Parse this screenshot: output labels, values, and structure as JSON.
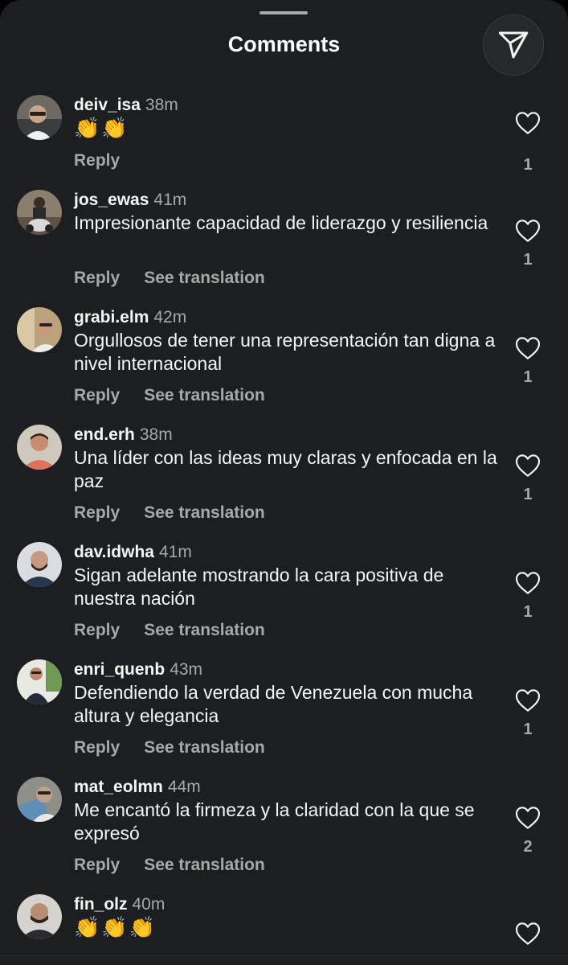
{
  "header": {
    "title": "Comments",
    "share_icon": "send-paper-plane-icon"
  },
  "colors": {
    "background": "#1c1e21",
    "text_primary": "#f5f5f5",
    "text_secondary": "#a8a8a8"
  },
  "comments": [
    {
      "username": "deiv_isa",
      "time": "38m",
      "text": "👏👏",
      "reply": "Reply",
      "translate": "",
      "likes": "1"
    },
    {
      "username": "jos_ewas",
      "time": "41m",
      "text": "Impresionante capacidad de liderazgo y resiliencia",
      "reply": "Reply",
      "translate": "See translation",
      "likes": "1"
    },
    {
      "username": "grabi.elm",
      "time": "42m",
      "text": "Orgullosos de tener una representación tan digna a nivel internacional",
      "reply": "Reply",
      "translate": "See translation",
      "likes": "1"
    },
    {
      "username": "end.erh",
      "time": "38m",
      "text": "Una líder con las ideas muy claras y enfocada en la paz",
      "reply": "Reply",
      "translate": "See translation",
      "likes": "1"
    },
    {
      "username": "dav.idwha",
      "time": "41m",
      "text": "Sigan adelante mostrando la cara positiva de nuestra nación",
      "reply": "Reply",
      "translate": "See translation",
      "likes": "1"
    },
    {
      "username": "enri_quenb",
      "time": "43m",
      "text": "Defendiendo la verdad de Venezuela con mucha altura y elegancia",
      "reply": "Reply",
      "translate": "See translation",
      "likes": "1"
    },
    {
      "username": "mat_eolmn",
      "time": "44m",
      "text": "Me encantó la firmeza y la claridad con la que se expresó",
      "reply": "Reply",
      "translate": "See translation",
      "likes": "2"
    },
    {
      "username": "fin_olz",
      "time": "40m",
      "text": "👏👏👏",
      "reply": "",
      "translate": "",
      "likes": ""
    }
  ]
}
